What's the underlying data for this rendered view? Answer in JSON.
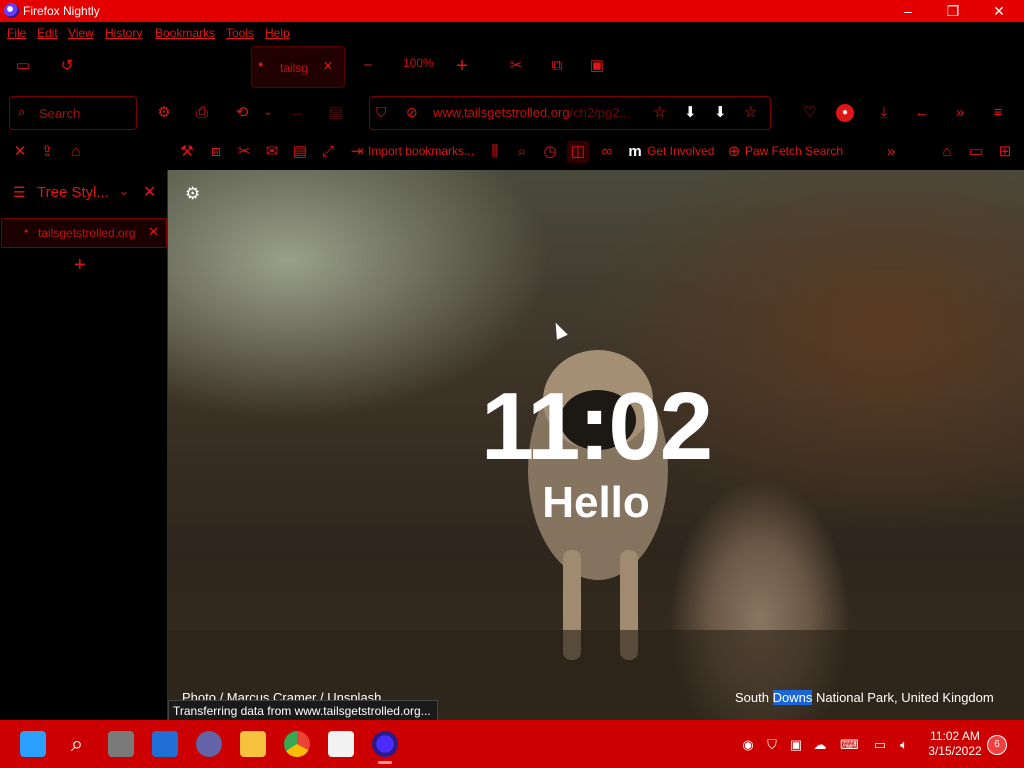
{
  "window": {
    "title": "Firefox Nightly",
    "minimize": "–",
    "maximize": "❐",
    "close": "✕"
  },
  "menu": {
    "file": "File",
    "edit": "Edit",
    "view": "View",
    "history": "History",
    "bookmarks": "Bookmarks",
    "tools": "Tools",
    "help": "Help"
  },
  "tabbar": {
    "tab_title": "tailsg",
    "zoom": "100%"
  },
  "navbar": {
    "search_placeholder": "Search",
    "url_host": "www.tailsgetstrolled.org",
    "url_path": "/ch2/pg2..."
  },
  "bookmarks": {
    "import": "Import bookmarks...",
    "get_involved": "Get Involved",
    "paw_fetch": "Paw Fetch Search"
  },
  "sidebar": {
    "title": "Tree Styl...",
    "tab_title": "tailsgetstrolled.org",
    "new_tab": "+"
  },
  "newtab": {
    "time": "11:02",
    "greeting": "Hello",
    "photo_credit": "Photo / Marcus Cramer / Unsplash",
    "location_prefix": "South ",
    "location_highlight": "Downs",
    "location_suffix": " National Park, United Kingdom"
  },
  "status": {
    "text": "Transferring data from www.tailsgetstrolled.org..."
  },
  "taskbar": {
    "time": "11:02 AM",
    "date": "3/15/2022",
    "notifications": "6"
  },
  "colors": {
    "accent": "#e50000",
    "menu_text": "#e01515",
    "taskbar": "#cc0000",
    "highlight": "#1a66d9"
  }
}
